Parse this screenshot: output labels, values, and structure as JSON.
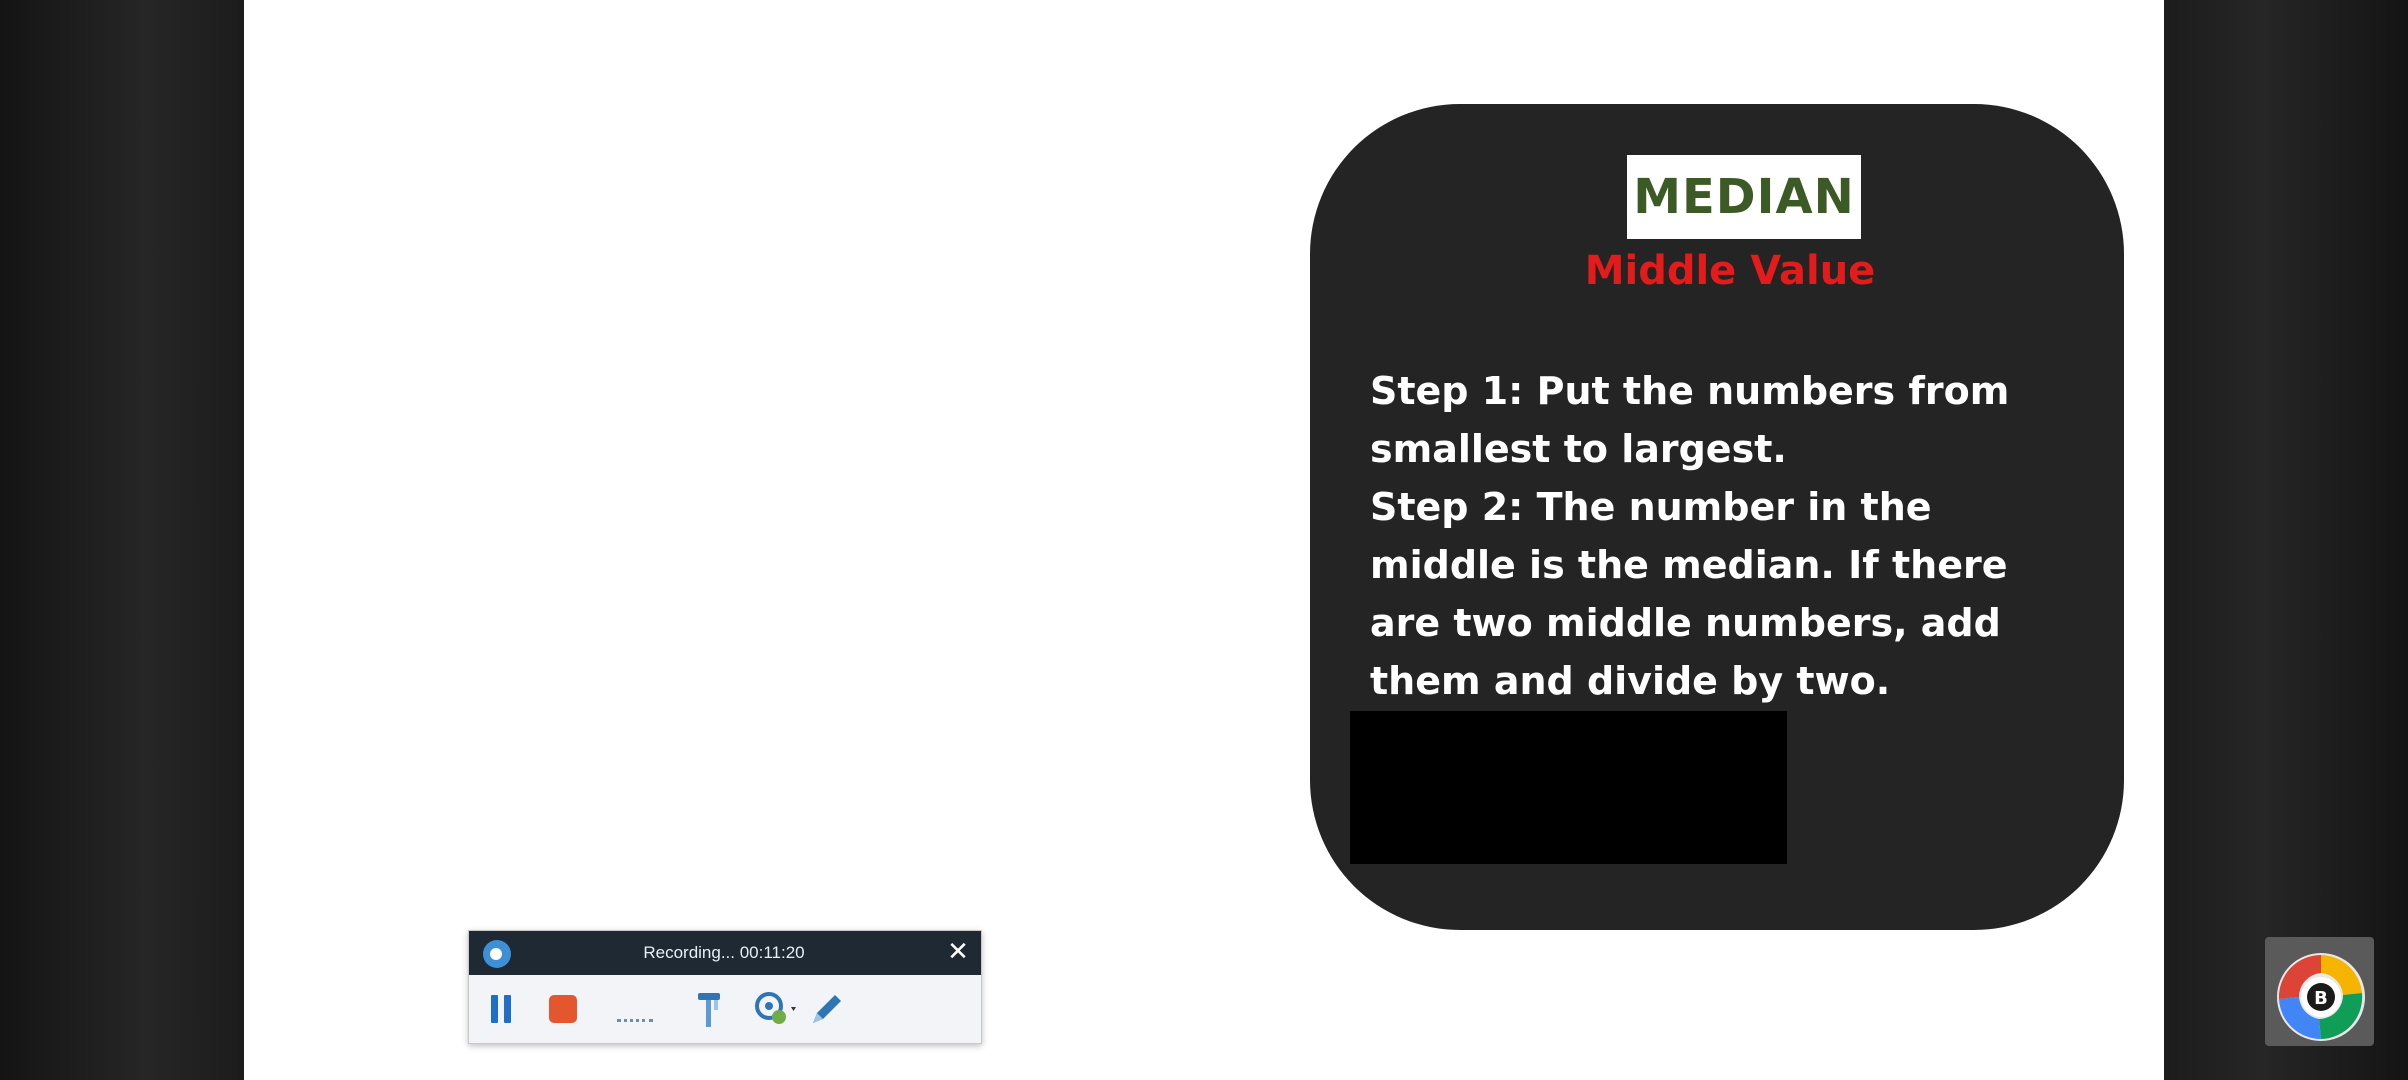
{
  "median_card": {
    "title": "MEDIAN",
    "subtitle": "Middle Value",
    "steps": [
      "Step 1: Put the numbers from smallest to largest.",
      "Step 2: The number in the middle is the median. If there are two middle numbers, add them and divide by two."
    ]
  },
  "recorder": {
    "status": "Recording... 00:11:20",
    "close_label": "✕",
    "icons": {
      "logo": "recorder-logo-icon",
      "pause": "pause-icon",
      "stop": "stop-icon",
      "audio": "audio-level-icon",
      "tools": "tools-icon",
      "webcam": "webcam-icon",
      "draw": "pencil-icon"
    }
  },
  "badge": {
    "letter": "B"
  },
  "colors": {
    "card_background": "#242424",
    "title_green": "#3c5a26",
    "subtitle_red": "#e31b1b",
    "recorder_header": "#1e2933",
    "pause_blue": "#1f6fc8",
    "stop_orange": "#e4572e"
  }
}
